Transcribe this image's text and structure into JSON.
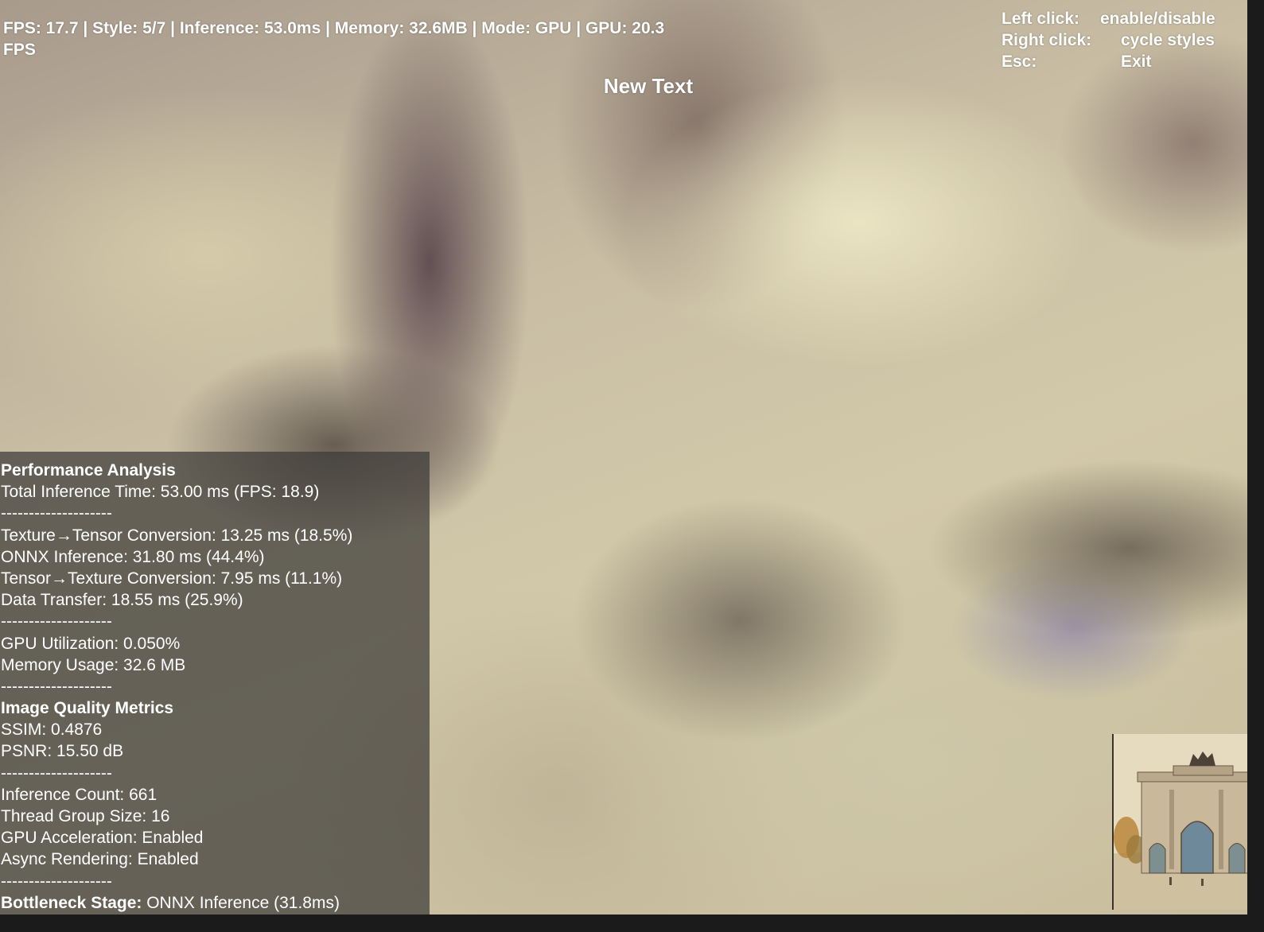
{
  "status_bar": {
    "text": "FPS: 17.7 | Style: 5/7 | Inference: 53.0ms | Memory: 32.6MB | Mode: GPU | GPU: 20.3 FPS"
  },
  "center_title": "New Text",
  "controls": [
    {
      "key": "Left click:",
      "action": "enable/disable"
    },
    {
      "key": "Right click:",
      "action": "cycle styles"
    },
    {
      "key": "Esc:",
      "action": "Exit"
    }
  ],
  "performance_panel": {
    "title": "Performance Analysis",
    "total_line": "Total Inference Time: 53.00 ms (FPS: 18.9)",
    "separator": "--------------------",
    "stages": [
      "Texture→Tensor Conversion: 13.25 ms (18.5%)",
      "ONNX Inference: 31.80 ms (44.4%)",
      "Tensor→Texture Conversion: 7.95 ms (11.1%)",
      "Data Transfer: 18.55 ms (25.9%)"
    ],
    "gpu_utilization": "GPU Utilization: 0.050%",
    "memory_usage": "Memory Usage: 32.6 MB",
    "quality_title": "Image Quality Metrics",
    "ssim": "SSIM: 0.4876",
    "psnr": "PSNR: 15.50 dB",
    "inference_count": "Inference Count: 661",
    "thread_group_size": "Thread Group Size: 16",
    "gpu_acceleration": "GPU Acceleration: Enabled",
    "async_rendering": "Async Rendering: Enabled",
    "bottleneck_label": "Bottleneck Stage:",
    "bottleneck_value": " ONNX Inference (31.8ms)"
  },
  "style_thumbnail": {
    "icon": "arch-painting-thumbnail"
  }
}
